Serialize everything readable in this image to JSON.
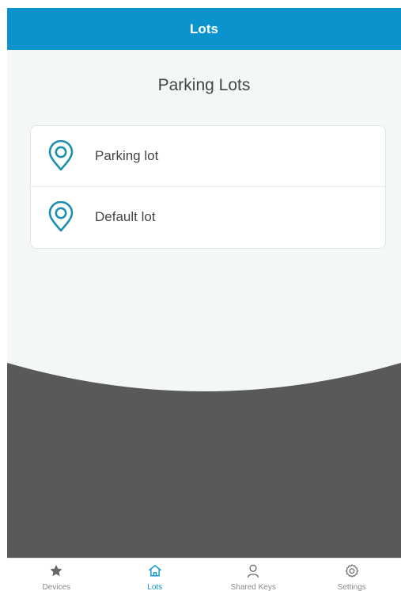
{
  "header": {
    "title": "Lots"
  },
  "main": {
    "title": "Parking Lots",
    "lots": [
      {
        "label": "Parking lot",
        "icon": "location-pin-icon"
      },
      {
        "label": "Default lot",
        "icon": "location-pin-icon"
      }
    ]
  },
  "tabbar": {
    "tabs": [
      {
        "label": "Devices",
        "icon": "star-icon",
        "active": false
      },
      {
        "label": "Lots",
        "icon": "home-icon",
        "active": true
      },
      {
        "label": "Shared Keys",
        "icon": "user-icon",
        "active": false
      },
      {
        "label": "Settings",
        "icon": "gear-icon",
        "active": false
      }
    ]
  },
  "colors": {
    "accent": "#0a93cc",
    "pin": "#1c8fb0",
    "background": "#f3f8f6",
    "dark_area": "#595959",
    "text": "#444444",
    "inactive_tab": "#8a8a8a"
  }
}
